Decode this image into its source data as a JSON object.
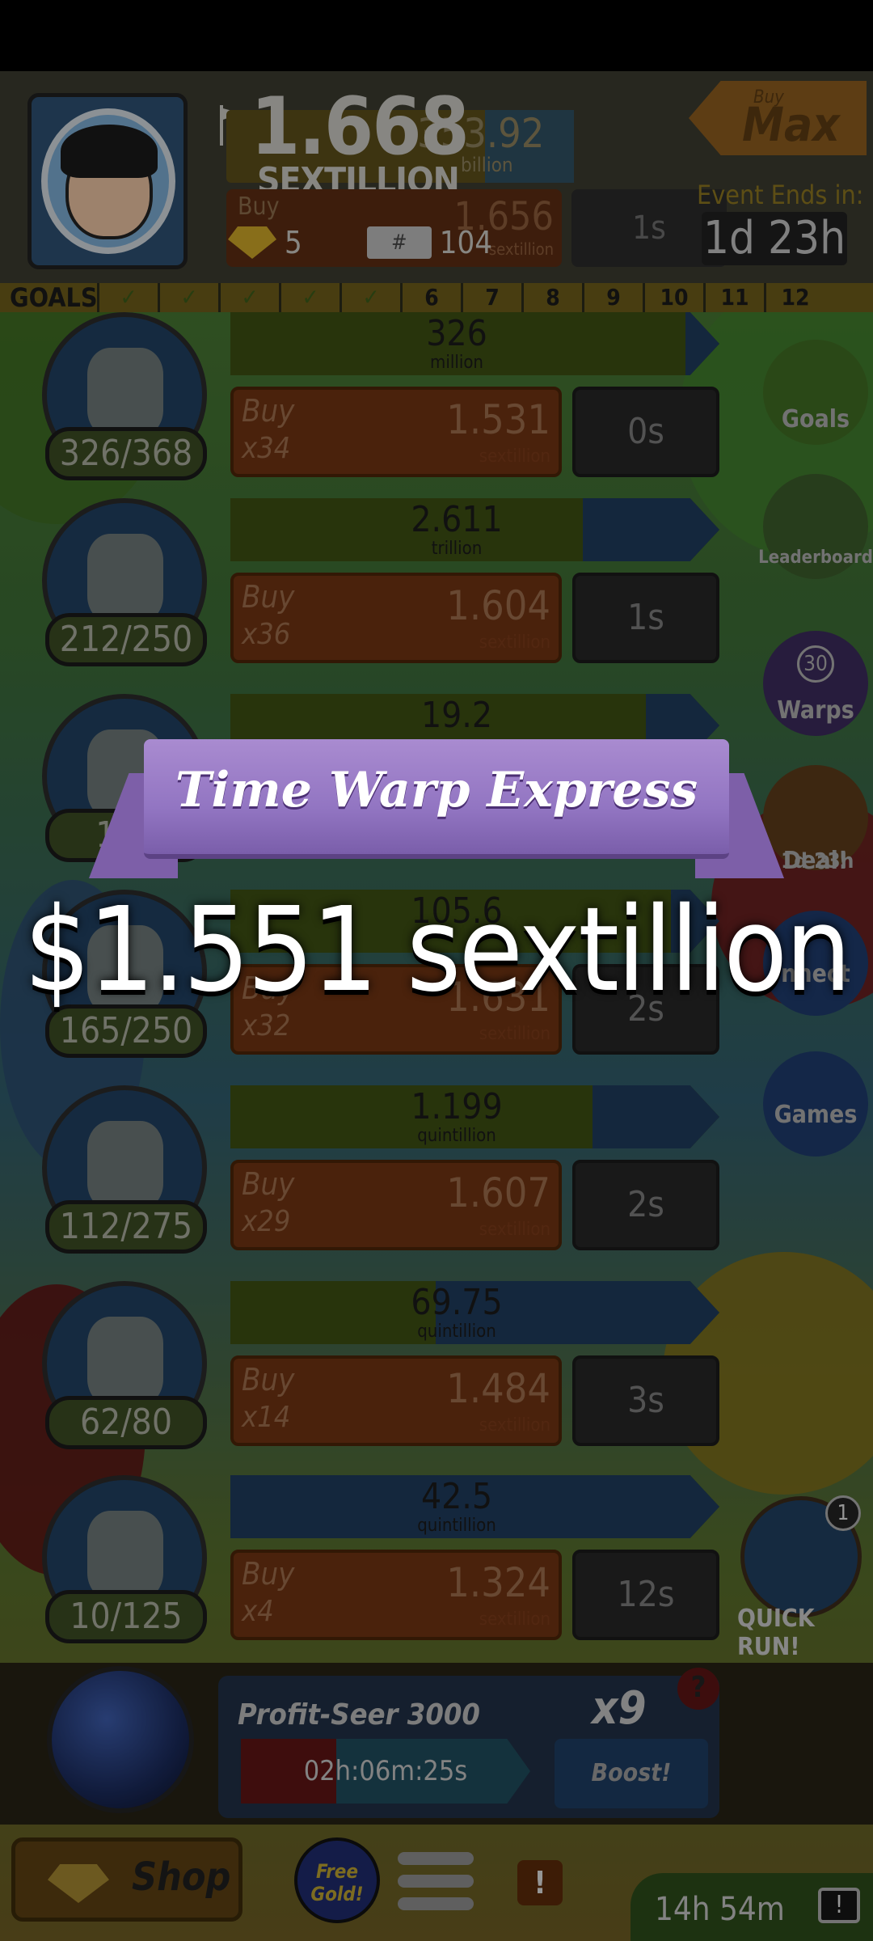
{
  "header": {
    "money_value": "1.668",
    "money_unit": "SEXTILLION",
    "partial_bar_value": "353.92",
    "partial_bar_unit": "billion",
    "partial_buy_label": "Buy",
    "partial_buy_value": "1.656",
    "partial_buy_unit": "sextillion",
    "partial_time": "1s",
    "gold_count": "5",
    "ticket_symbol": "#",
    "ticket_count": "104",
    "buy_small": "Buy",
    "buy_max": "Max",
    "event_label": "Event Ends in:",
    "event_time": "1d 23h"
  },
  "goals": {
    "label": "GOALS",
    "cells": [
      "✓",
      "✓",
      "✓",
      "✓",
      "✓",
      "6",
      "7",
      "8",
      "9",
      "10",
      "11",
      "12"
    ],
    "completed": 5
  },
  "rows": [
    {
      "count": "326/368",
      "bar_value": "326",
      "bar_unit": "million",
      "buy": "Buy",
      "mult": "x34",
      "cost": "1.531",
      "cost_unit": "sextillion",
      "time": "0s",
      "progress": 0.93
    },
    {
      "count": "212/250",
      "bar_value": "2.611",
      "bar_unit": "trillion",
      "buy": "Buy",
      "mult": "x36",
      "cost": "1.604",
      "cost_unit": "sextillion",
      "time": "1s",
      "progress": 0.72
    },
    {
      "count": "192",
      "bar_value": "19.2",
      "bar_unit": "",
      "buy": "",
      "mult": "",
      "cost": "",
      "cost_unit": "",
      "time": "",
      "progress": 0.85
    },
    {
      "count": "165/250",
      "bar_value": "105.6",
      "bar_unit": "",
      "buy": "Buy",
      "mult": "x32",
      "cost": "1.631",
      "cost_unit": "sextillion",
      "time": "2s",
      "progress": 0.9
    },
    {
      "count": "112/275",
      "bar_value": "1.199",
      "bar_unit": "quintillion",
      "buy": "Buy",
      "mult": "x29",
      "cost": "1.607",
      "cost_unit": "sextillion",
      "time": "2s",
      "progress": 0.74
    },
    {
      "count": "62/80",
      "bar_value": "69.75",
      "bar_unit": "quintillion",
      "buy": "Buy",
      "mult": "x14",
      "cost": "1.484",
      "cost_unit": "sextillion",
      "time": "3s",
      "progress": 0.42
    },
    {
      "count": "10/125",
      "bar_value": "42.5",
      "bar_unit": "quintillion",
      "buy": "Buy",
      "mult": "x4",
      "cost": "1.324",
      "cost_unit": "sextillion",
      "time": "12s",
      "progress": 0.0
    }
  ],
  "side_buttons": {
    "goals": "Goals",
    "leaderboard": "Leaderboard",
    "warps": "Warps",
    "warps_count": "30",
    "deal": "Deal!",
    "deal_time": "1d 23h",
    "connect": "nnect",
    "games": "Games"
  },
  "quick_run": {
    "label": "QUICK RUN!",
    "badge": "1"
  },
  "manager": {
    "name": "Profit-Seer 3000",
    "multiplier": "x9",
    "help": "?",
    "timer": "02h:06m:25s",
    "timer_progress": 0.33,
    "boost": "Boost!"
  },
  "bottom_nav": {
    "shop": "Shop",
    "free_gold": "Free Gold!",
    "alert": "!",
    "idle_time": "14h 54m",
    "tv_icon": "!"
  },
  "banner": {
    "title": "Time Warp Express",
    "amount": "$1.551 sextillion"
  },
  "colors": {
    "ribbon": "#9275c2",
    "overlay": "#000000"
  }
}
